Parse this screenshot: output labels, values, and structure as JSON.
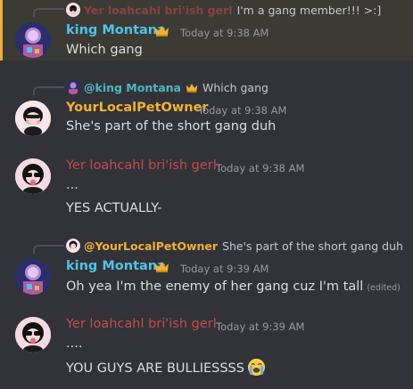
{
  "colors": {
    "king": "#4fc3e8",
    "pet": "#f0b232",
    "yer": "#c44b4b",
    "mention": "#4fb6c2"
  },
  "messages": [
    {
      "reply": {
        "author": "Yer loahcahl bri'ish gerl",
        "text": "I'm a gang member!!! >:]"
      },
      "author": "king Montana",
      "timestamp": "Today at 9:38 AM",
      "lines": [
        "Which gang"
      ]
    },
    {
      "reply": {
        "author": "@king Montana",
        "text": "Which gang"
      },
      "author": "YourLocalPetOwner",
      "timestamp": "Today at 9:38 AM",
      "lines": [
        "She's part of the short gang duh"
      ]
    },
    {
      "author": "Yer loahcahl bri'ish gerl",
      "timestamp": "Today at 9:38 AM",
      "lines": [
        "...",
        "YES ACTUALLY-"
      ]
    },
    {
      "reply": {
        "author": "@YourLocalPetOwner",
        "text": "She's part of the short gang duh"
      },
      "author": "king Montana",
      "timestamp": "Today at 9:39 AM",
      "lines": [
        "Oh yea I'm the enemy of her gang cuz I'm tall"
      ],
      "edited": "(edited)"
    },
    {
      "author": "Yer loahcahl bri'ish gerl",
      "timestamp": "Today at 9:39 AM",
      "lines": [
        "....",
        "YOU GUYS ARE BULLIESSSS"
      ],
      "emoji": "loudly-crying-face"
    }
  ]
}
